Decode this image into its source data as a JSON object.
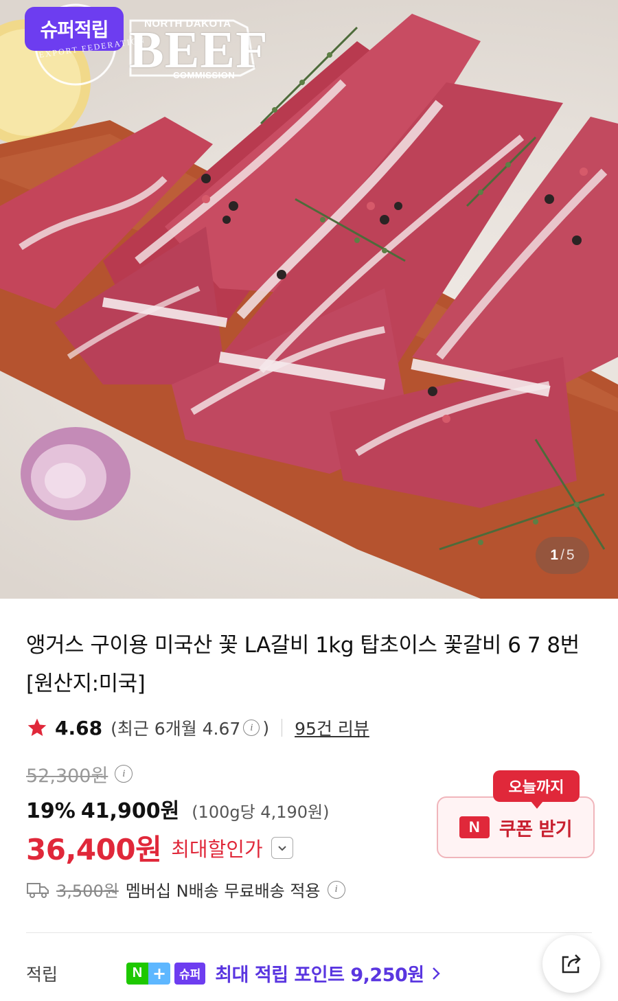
{
  "hero": {
    "super_badge": "슈퍼적립",
    "brand_top": "NORTH DAKOTA",
    "brand_main": "BEEF",
    "brand_sub": "COMMISSION",
    "seal_text": "EXPORT FEDERATION",
    "counter_current": "1",
    "counter_separator": "/",
    "counter_total": "5"
  },
  "product": {
    "title": "앵거스 구이용 미국산 꽃 LA갈비 1kg 탑초이스 꽃갈비 6 7 8번 [원산지:미국]"
  },
  "rating": {
    "score": "4.68",
    "recent_prefix": "(최근 6개월 4.67",
    "recent_suffix": ")",
    "reviews": "95건 리뷰"
  },
  "price": {
    "original": "52,300원",
    "discount_pct": "19%",
    "sale": "41,900원",
    "unit": "(100g당 4,190원)",
    "final": "36,400원",
    "final_label": "최대할인가"
  },
  "coupon": {
    "tag": "오늘까지",
    "icon": "N",
    "label": "쿠폰 받기"
  },
  "shipping": {
    "original_fee": "3,500원",
    "text": "멤버십 N배송 무료배송 적용"
  },
  "accumulate": {
    "label": "적립",
    "badge_n": "N",
    "badge_plus": "+",
    "badge_super": "슈퍼",
    "text": "최대 적립 포인트 9,250원"
  },
  "colors": {
    "accent_red": "#e0283a",
    "super_purple": "#6d3df0",
    "naver_green": "#1ec800"
  }
}
